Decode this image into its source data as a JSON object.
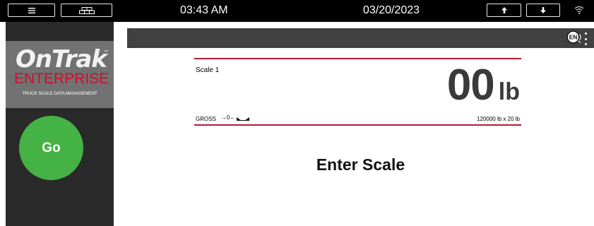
{
  "status_bar": {
    "time": "03:43 AM",
    "date": "03/20/2023",
    "icons": [
      "menu-icon",
      "grid-icon",
      "arrow-up-icon",
      "arrow-down-icon",
      "wifi-icon"
    ]
  },
  "sidebar": {
    "logo": {
      "brand": "OnTrak",
      "trademark": "™",
      "product": "ENTERPRISE",
      "tagline": "TRUCK SCALE DATA MANAGEMENT"
    },
    "go_button": "Go"
  },
  "header": {
    "language_icon": "language-en-icon",
    "language_code": "EN",
    "more_icon": "kebab-menu-icon"
  },
  "scale": {
    "name": "Scale 1",
    "weight": "00",
    "unit": "lb",
    "mode": "GROSS",
    "center_zero": "→0←",
    "motion_icon": "motion-indicator-icon",
    "capacity": "120000 lb x 20 lb"
  },
  "prompt": "Enter Scale",
  "colors": {
    "topbar": "#000000",
    "sidebar": "#2a2a2a",
    "logo_bg": "#727272",
    "brand_red": "#c8102e",
    "go_green": "#45b245",
    "panel_border": "#b41c34",
    "header_strip": "#414141"
  }
}
